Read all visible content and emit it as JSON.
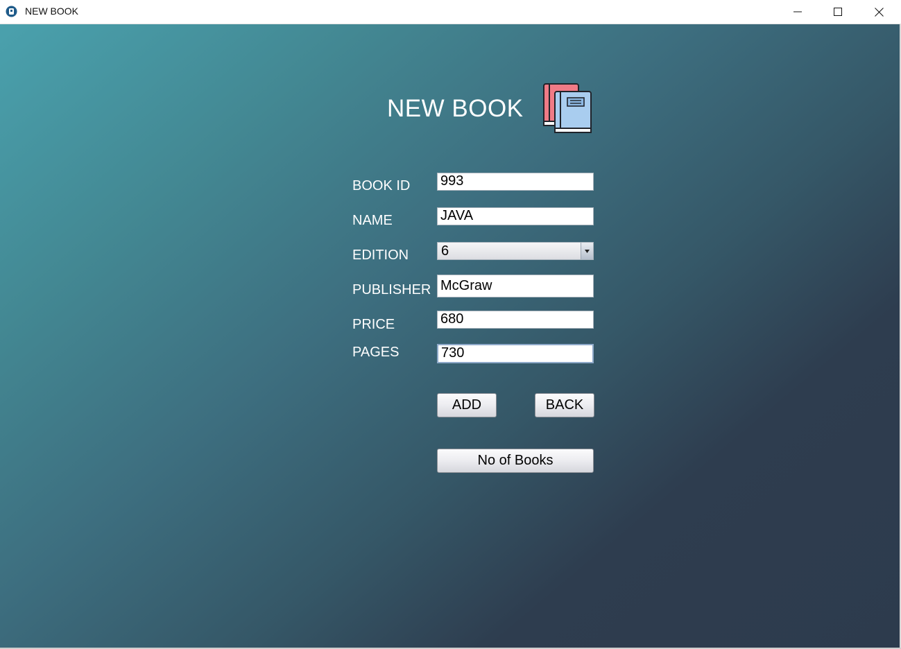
{
  "window": {
    "title": "NEW BOOK"
  },
  "form": {
    "heading": "NEW BOOK",
    "fields": {
      "book_id": {
        "label": "BOOK ID",
        "value": "993"
      },
      "name": {
        "label": "NAME",
        "value": "JAVA"
      },
      "edition": {
        "label": "EDITION",
        "value": "6"
      },
      "publisher": {
        "label": "PUBLISHER",
        "value": "McGraw"
      },
      "price": {
        "label": "PRICE",
        "value": "680"
      },
      "pages": {
        "label": "PAGES",
        "value": "730"
      }
    },
    "buttons": {
      "add": "ADD",
      "back": "BACK",
      "count": "No of Books"
    }
  },
  "icons": {
    "app": "app-icon",
    "heading": "books-icon",
    "minimize": "minimize-icon",
    "maximize": "maximize-icon",
    "close": "close-icon",
    "dropdown": "chevron-down-icon"
  },
  "colors": {
    "gradient_start": "#4aa1ad",
    "gradient_end": "#2d3b4d",
    "text_on_background": "#ffffff"
  }
}
